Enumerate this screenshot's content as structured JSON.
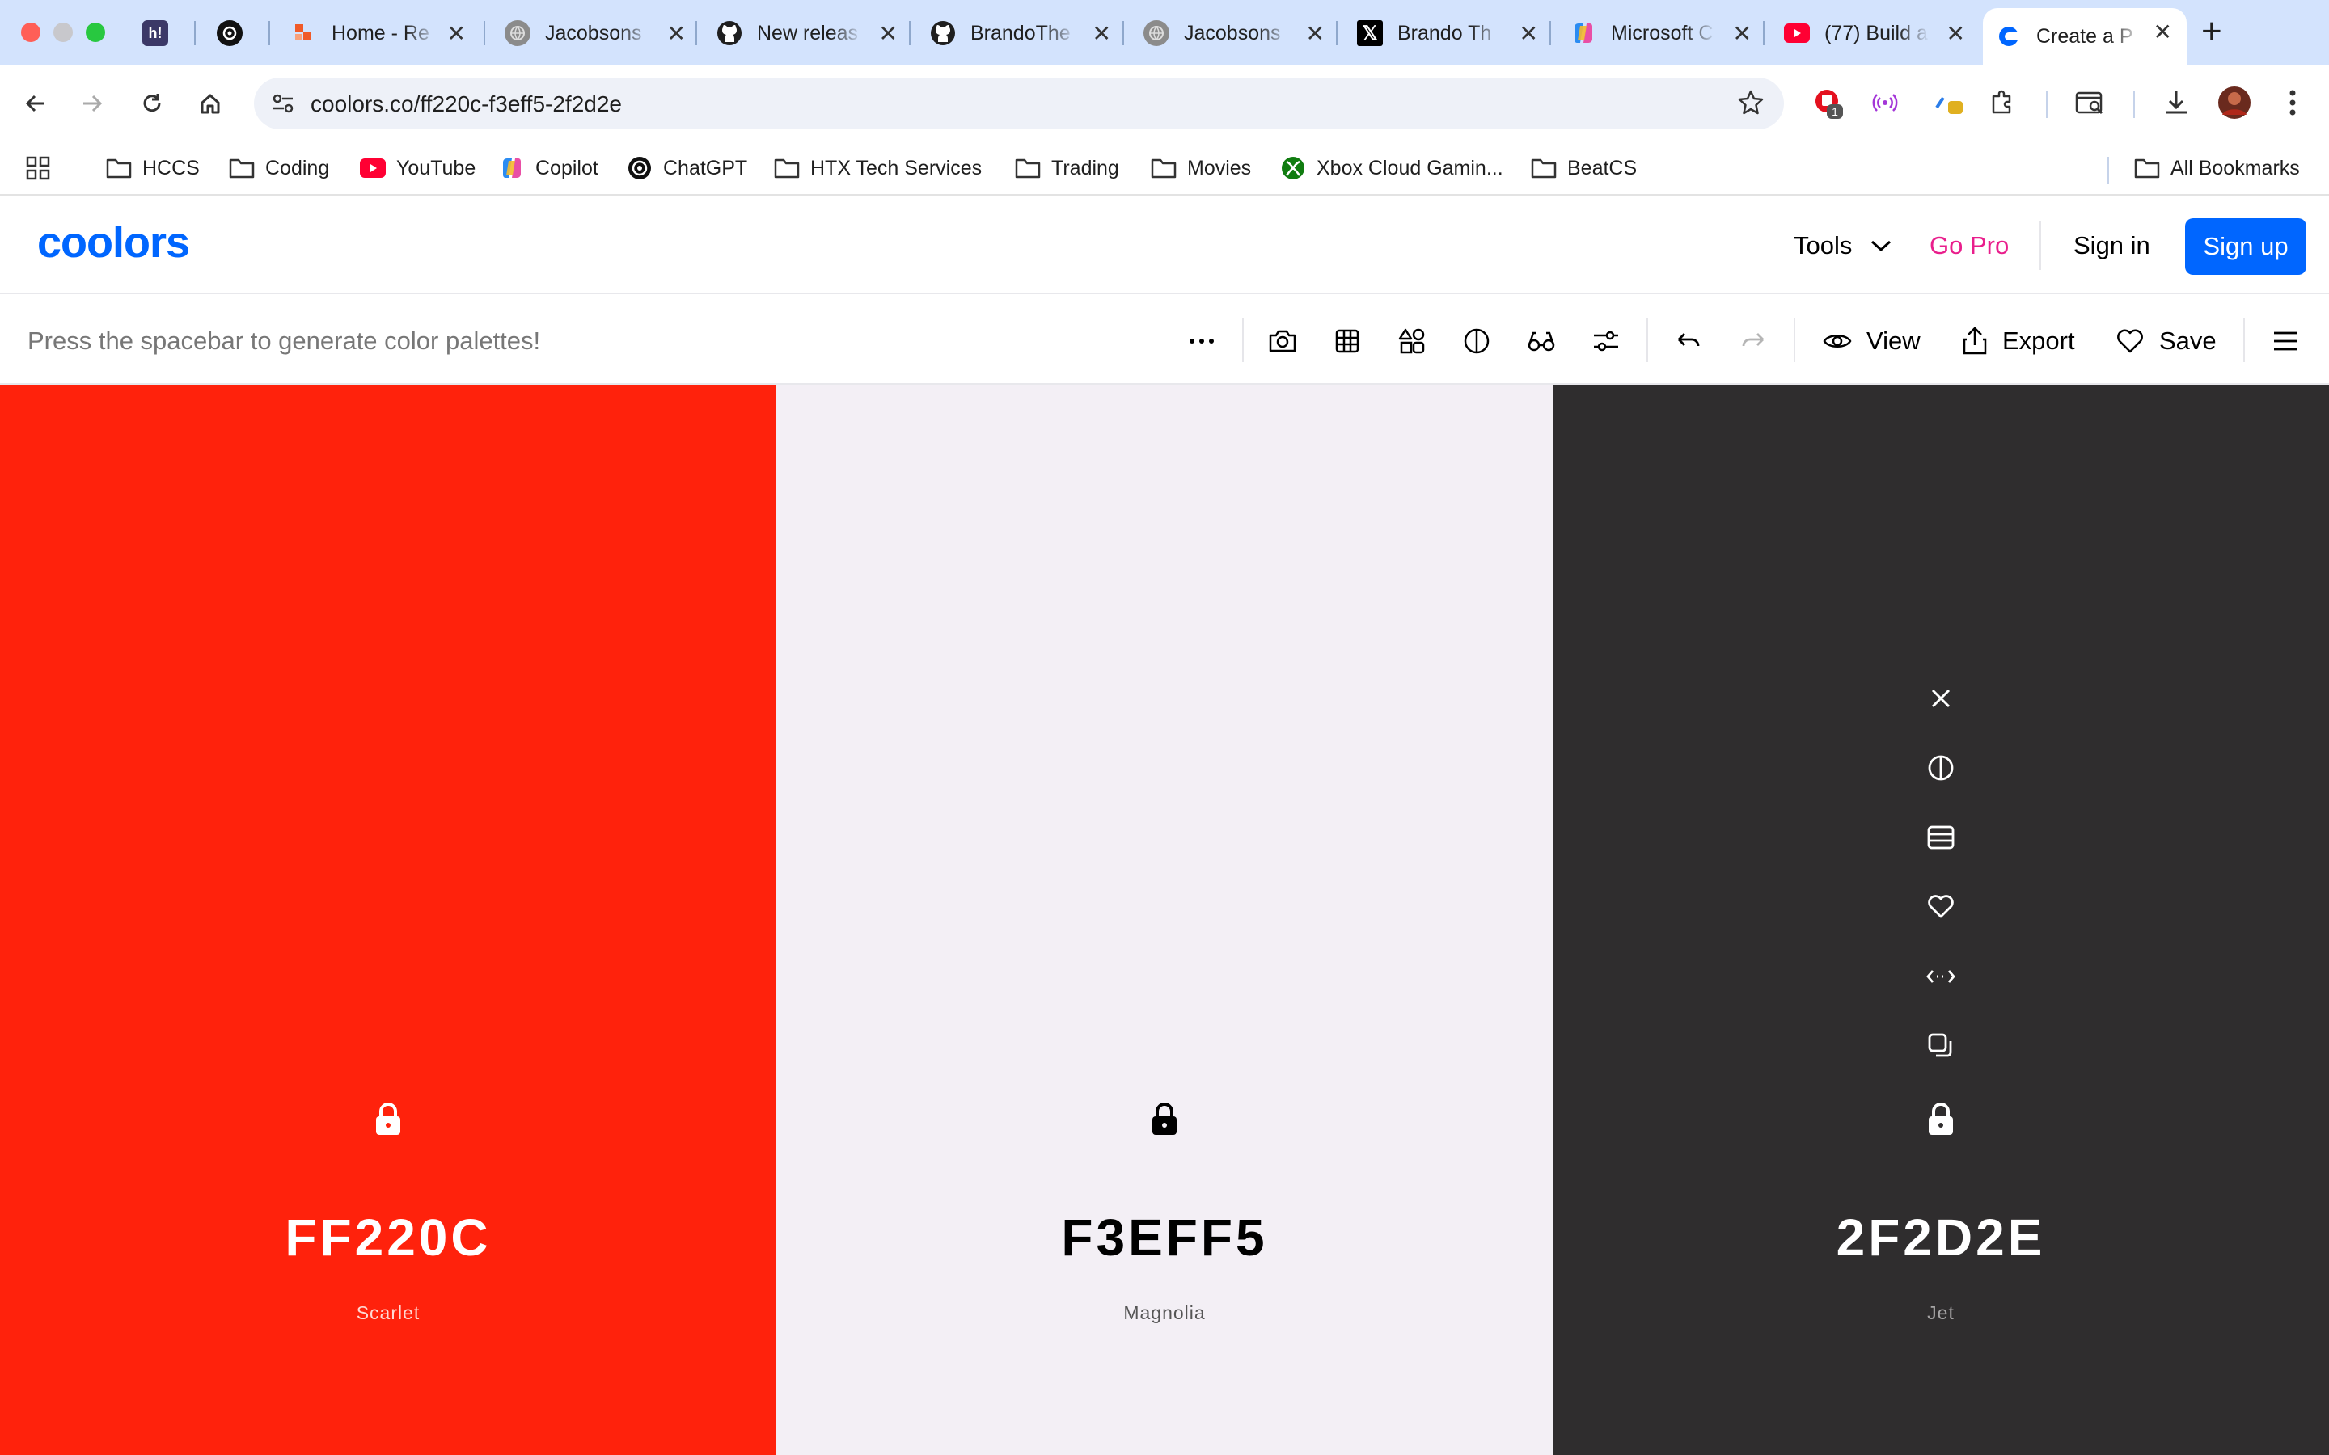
{
  "browser": {
    "tabs": [
      {
        "title": "",
        "icon": "hashnode-icon"
      },
      {
        "title": "",
        "icon": "openai-icon"
      },
      {
        "title": "Home - Re",
        "icon": "relume-icon"
      },
      {
        "title": "Jacobsons",
        "icon": "globe-icon"
      },
      {
        "title": "New releas",
        "icon": "github-icon"
      },
      {
        "title": "BrandoThe",
        "icon": "github-icon"
      },
      {
        "title": "Jacobsons",
        "icon": "globe-icon"
      },
      {
        "title": "Brando Th",
        "icon": "x-icon"
      },
      {
        "title": "Microsoft C",
        "icon": "copilot-icon"
      },
      {
        "title": "(77) Build a",
        "icon": "youtube-icon"
      },
      {
        "title": "Create a P",
        "icon": "coolors-icon",
        "active": true
      }
    ],
    "address": "coolors.co/ff220c-f3eff5-2f2d2e",
    "extension_badge": "1",
    "bookmarks": [
      {
        "label": "HCCS",
        "icon": "folder-icon"
      },
      {
        "label": "Coding",
        "icon": "folder-icon"
      },
      {
        "label": "YouTube",
        "icon": "youtube-icon"
      },
      {
        "label": "Copilot",
        "icon": "copilot-icon"
      },
      {
        "label": "ChatGPT",
        "icon": "openai-icon"
      },
      {
        "label": "HTX Tech Services",
        "icon": "folder-icon"
      },
      {
        "label": "Trading",
        "icon": "folder-icon"
      },
      {
        "label": "Movies",
        "icon": "folder-icon"
      },
      {
        "label": "Xbox Cloud Gamin...",
        "icon": "xbox-icon"
      },
      {
        "label": "BeatCS",
        "icon": "folder-icon"
      }
    ],
    "all_bookmarks": "All Bookmarks"
  },
  "site": {
    "logo": "coolors",
    "nav": {
      "tools": "Tools",
      "go_pro": "Go Pro",
      "sign_in": "Sign in",
      "sign_up": "Sign up"
    },
    "colors": {
      "brand": "#0066ff",
      "go_pro": "#e91e8c"
    }
  },
  "palette_bar": {
    "hint": "Press the spacebar to generate color palettes!",
    "view": "View",
    "export": "Export",
    "save": "Save"
  },
  "palette": [
    {
      "hex": "FF220C",
      "name": "Scarlet",
      "color": "#ff220c",
      "text_color": "#ffffff",
      "locked": false
    },
    {
      "hex": "F3EFF5",
      "name": "Magnolia",
      "color": "#f3eff5",
      "text_color": "#000000",
      "locked": false
    },
    {
      "hex": "2F2D2E",
      "name": "Jet",
      "color": "#2f2d2e",
      "text_color": "#ffffff",
      "locked": false,
      "hovered": true
    }
  ]
}
